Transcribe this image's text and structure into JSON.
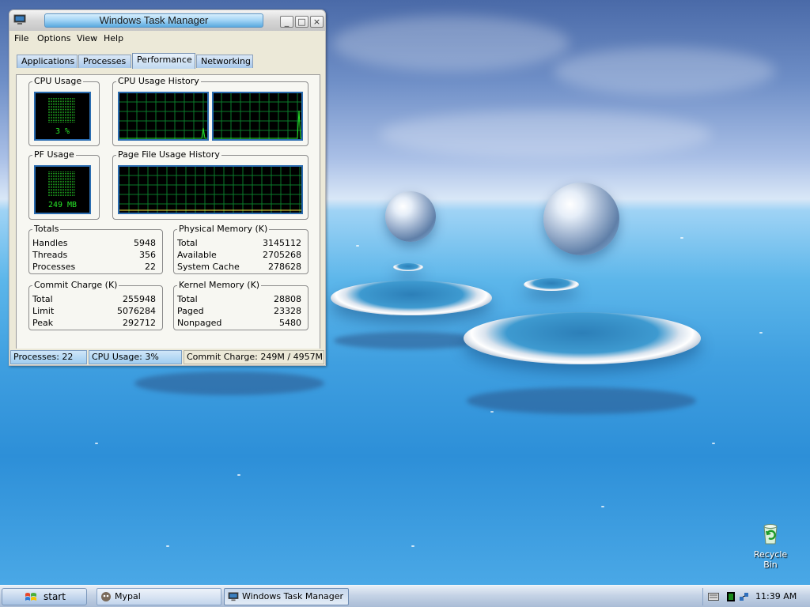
{
  "window": {
    "title": "Windows Task Manager",
    "controls": {
      "minimize": "_",
      "maximize": "□",
      "close": "×"
    }
  },
  "menu": [
    "File",
    "Options",
    "View",
    "Help"
  ],
  "tabs": [
    {
      "label": "Applications",
      "active": false
    },
    {
      "label": "Processes",
      "active": false
    },
    {
      "label": "Performance",
      "active": true
    },
    {
      "label": "Networking",
      "active": false
    }
  ],
  "performance": {
    "cpu_usage": {
      "title": "CPU Usage",
      "value": "3 %",
      "fraction": 0.03
    },
    "cpu_history": {
      "title": "CPU Usage History"
    },
    "pf_usage": {
      "title": "PF Usage",
      "value": "249 MB"
    },
    "pf_history": {
      "title": "Page File Usage History"
    },
    "totals": {
      "title": "Totals",
      "rows": [
        {
          "label": "Handles",
          "value": "5948"
        },
        {
          "label": "Threads",
          "value": "356"
        },
        {
          "label": "Processes",
          "value": "22"
        }
      ]
    },
    "physical_memory": {
      "title": "Physical Memory (K)",
      "rows": [
        {
          "label": "Total",
          "value": "3145112"
        },
        {
          "label": "Available",
          "value": "2705268"
        },
        {
          "label": "System Cache",
          "value": "278628"
        }
      ]
    },
    "commit_charge": {
      "title": "Commit Charge (K)",
      "rows": [
        {
          "label": "Total",
          "value": "255948"
        },
        {
          "label": "Limit",
          "value": "5076284"
        },
        {
          "label": "Peak",
          "value": "292712"
        }
      ]
    },
    "kernel_memory": {
      "title": "Kernel Memory (K)",
      "rows": [
        {
          "label": "Total",
          "value": "28808"
        },
        {
          "label": "Paged",
          "value": "23328"
        },
        {
          "label": "Nonpaged",
          "value": "5480"
        }
      ]
    }
  },
  "status_bar": {
    "processes": "Processes: 22",
    "cpu": "CPU Usage: 3%",
    "commit": "Commit Charge: 249M / 4957M"
  },
  "taskbar": {
    "start_label": "start",
    "tasks": [
      {
        "label": "Mypal",
        "active": false
      },
      {
        "label": "Windows Task Manager",
        "active": true
      }
    ],
    "clock": "11:39 AM"
  },
  "desktop": {
    "recycle_bin_label": "Recycle Bin"
  },
  "colors": {
    "graph_grid": "#0a7a2a",
    "graph_line": "#28e428",
    "meter_text": "#28e428",
    "graph_border": "#2a6cb0"
  }
}
